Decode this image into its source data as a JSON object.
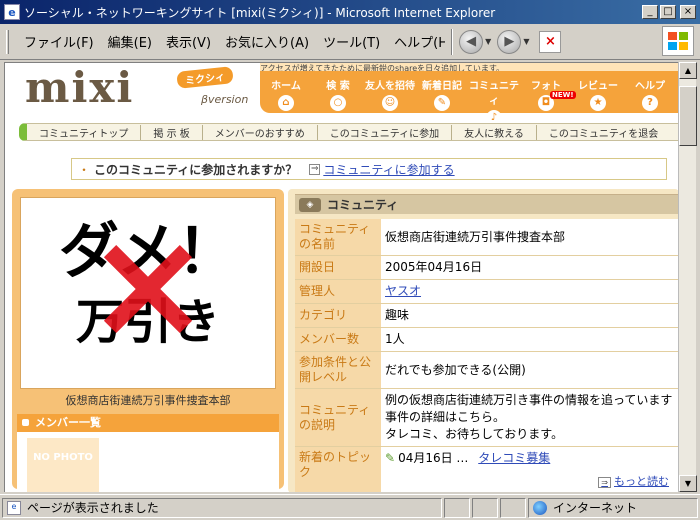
{
  "window": {
    "title": "ソーシャル・ネットワーキングサイト [mixi(ミクシィ)] - Microsoft Internet Explorer",
    "min": "_",
    "max": "□",
    "close": "×"
  },
  "menu": [
    "ファイル(F)",
    "編集(E)",
    "表示(V)",
    "お気に入り(A)",
    "ツール(T)",
    "ヘルプ(H)"
  ],
  "toolbar": {
    "back": "◀",
    "forward": "▶",
    "stop": "×"
  },
  "mixi": {
    "logo": "mixi",
    "logo_kana": "ミクシィ",
    "beta": "βversion",
    "banner": "アクセスが増えてきたために最新鋭のshareを日々追加しています。",
    "nav": [
      {
        "label": "ホーム",
        "icon": "⌂"
      },
      {
        "label": "検 索",
        "icon": "○"
      },
      {
        "label": "友人を招待",
        "icon": "☺"
      },
      {
        "label": "新着日記",
        "icon": "✎"
      },
      {
        "label": "コミュニティ",
        "icon": "♪"
      },
      {
        "label": "フォト",
        "icon": "◘"
      },
      {
        "label": "レビュー",
        "icon": "★"
      },
      {
        "label": "ヘルプ",
        "icon": "?"
      }
    ],
    "new_badge": "NEW!"
  },
  "community_nav": [
    "コミュニティトップ",
    "掲 示 板",
    "メンバーのおすすめ",
    "このコミュニティに参加",
    "友人に教える",
    "このコミュニティを退会"
  ],
  "join": {
    "bullet": "・",
    "question": "このコミュニティに参加されますか？",
    "arrow": "⇒",
    "link": "コミュニティに参加する"
  },
  "photo": {
    "line1": "ダメ！",
    "line2": "万引き",
    "cross": "×",
    "caption": "仮想商店街連続万引事件捜査本部"
  },
  "members": {
    "title": "メンバー一覧",
    "nophoto": "NO PHOTO"
  },
  "info": {
    "header": "コミュニティ",
    "header_icon": "◈",
    "rows": [
      {
        "key": "コミュニティの名前",
        "value": "仮想商店街連続万引事件捜査本部"
      },
      {
        "key": "開設日",
        "value": "2005年04月16日"
      },
      {
        "key": "管理人",
        "value": "ヤスオ"
      },
      {
        "key": "カテゴリ",
        "value": "趣味"
      },
      {
        "key": "メンバー数",
        "value": "1人"
      },
      {
        "key": "参加条件と公開レベル",
        "value": "だれでも参加できる(公開)"
      },
      {
        "key": "コミュニティの説明",
        "value_lines": [
          "例の仮想商店街連続万引き事件の情報を追っています",
          "事件の詳細はこちら。",
          "タレコミ、お待ちしております。"
        ]
      },
      {
        "key": "新着のトピック",
        "date": "04月16日 …",
        "topic": "タレコミ募集",
        "more": "もっと読む",
        "more_arrow": "⇒"
      }
    ]
  },
  "status": {
    "text": "ページが表示されました",
    "zone": "インターネット"
  },
  "colors": {
    "title_bar": "#0a246a",
    "mixi_orange": "#f5a33b",
    "label_orange": "#c97a16",
    "link_blue": "#2f4bb8",
    "cross_red": "#e0101a"
  }
}
